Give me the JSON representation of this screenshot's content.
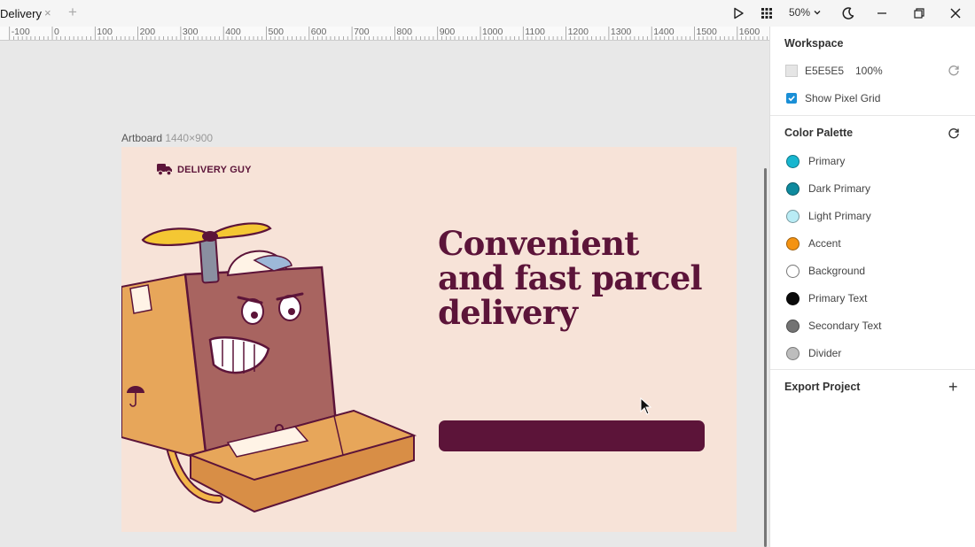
{
  "window": {
    "tab_title": "Delivery",
    "tab_close": "×",
    "tab_add": "+",
    "zoom_label": "50%"
  },
  "icons": {
    "play": "play-icon",
    "grid": "apps-grid-icon",
    "zoom_dropdown": "chevron-down-icon",
    "theme": "moon-icon",
    "minimize": "minimize-icon",
    "restore": "restore-icon",
    "close": "close-icon"
  },
  "ruler": {
    "labels": [
      "-100",
      "0",
      "100",
      "200",
      "300",
      "400",
      "500",
      "600",
      "700",
      "800",
      "900",
      "1000",
      "1100",
      "1200",
      "1300",
      "1400",
      "1500",
      "1600"
    ]
  },
  "artboard": {
    "name": "Artboard",
    "size": "1440×900",
    "brand": "DELIVERY GUY",
    "headline_lines": [
      "Convenient",
      "and fast parcel",
      "delivery"
    ],
    "cta_color": "#5c1439",
    "background_color": "#f7e3d8"
  },
  "panel": {
    "workspace": {
      "title": "Workspace",
      "color_hex": "E5E5E5",
      "opacity": "100%",
      "show_pixel_grid_label": "Show Pixel Grid",
      "show_pixel_grid_checked": true
    },
    "palette": {
      "title": "Color Palette",
      "items": [
        {
          "label": "Primary",
          "color": "#17b6cf"
        },
        {
          "label": "Dark Primary",
          "color": "#0e8a9e"
        },
        {
          "label": "Light Primary",
          "color": "#b9ecf5"
        },
        {
          "label": "Accent",
          "color": "#f49312"
        },
        {
          "label": "Background",
          "color": "#ffffff"
        },
        {
          "label": "Primary Text",
          "color": "#0a0a0a"
        },
        {
          "label": "Secondary Text",
          "color": "#737373"
        },
        {
          "label": "Divider",
          "color": "#bdbdbd"
        }
      ]
    },
    "export": {
      "title": "Export Project",
      "add": "+"
    }
  }
}
